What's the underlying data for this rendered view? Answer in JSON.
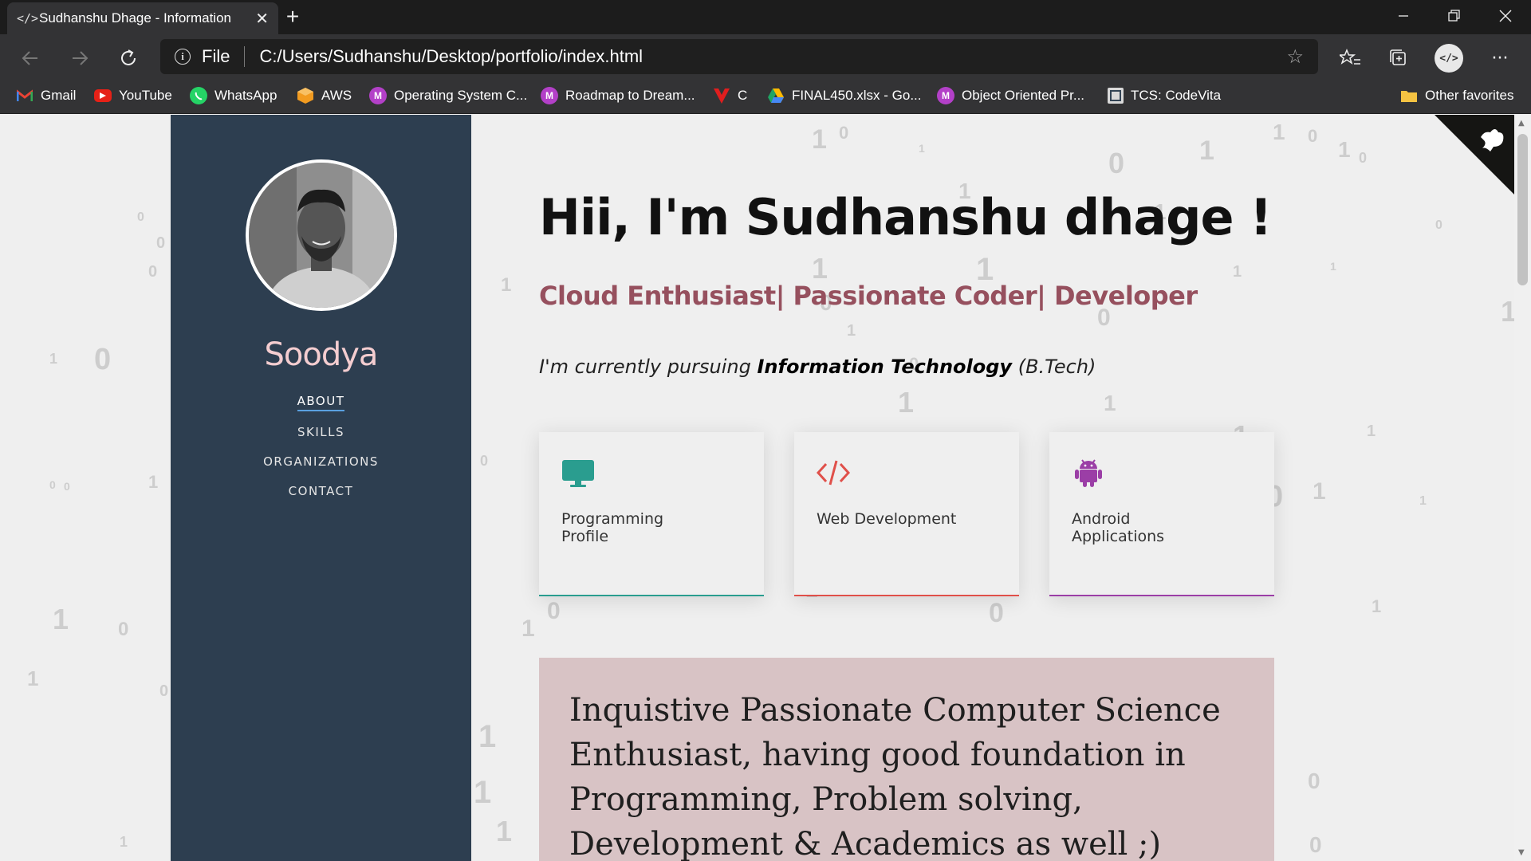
{
  "browser": {
    "tab_title": "Sudhanshu Dhage - Information",
    "tab_icon": "</>",
    "new_tab": "+",
    "scheme": "File",
    "url": "C:/Users/Sudhanshu/Desktop/portfolio/index.html",
    "profile_initials": "</>",
    "more": "···"
  },
  "bookmarks": [
    {
      "label": "Gmail",
      "icon": "gmail-icon"
    },
    {
      "label": "YouTube",
      "icon": "youtube-icon"
    },
    {
      "label": "WhatsApp",
      "icon": "whatsapp-icon"
    },
    {
      "label": "AWS",
      "icon": "aws-icon"
    },
    {
      "label": "Operating System C...",
      "icon": "m-icon"
    },
    {
      "label": "Roadmap to Dream...",
      "icon": "m-icon"
    },
    {
      "label": "C",
      "icon": "v-icon"
    },
    {
      "label": "FINAL450.xlsx - Go...",
      "icon": "drive-icon"
    },
    {
      "label": "Object Oriented Pr...",
      "icon": "m-icon"
    },
    {
      "label": "TCS: CodeVita",
      "icon": "codevita-icon"
    }
  ],
  "other_favorites": "Other favorites",
  "m_letter": "M",
  "sidebar": {
    "name": "Soodya",
    "nav": [
      "ABOUT",
      "SKILLS",
      "ORGANIZATIONS",
      "CONTACT"
    ]
  },
  "hero": {
    "title": "Hii, I'm Sudhanshu dhage !",
    "subtitle": "Cloud Enthusiast| Passionate Coder| Developer",
    "pursuit_prefix": "I'm currently pursuing ",
    "pursuit_field": "Information Technology",
    "pursuit_suffix": " (B.Tech)"
  },
  "cards": [
    {
      "label": "Programming Profile",
      "icon": "monitor-icon",
      "color": "#2a9d8f"
    },
    {
      "label": "Web Development",
      "icon": "code-icon",
      "color": "#e0504a"
    },
    {
      "label": "Android Applications",
      "icon": "android-icon",
      "color": "#9b3ea6"
    }
  ],
  "about": "Inquistive Passionate Computer Science Enthusiast, having good foundation in Programming, Problem solving, Development & Academics as well ;)",
  "colors": {
    "sidebar_bg": "#2d3e50",
    "name_color": "#f4cdd0",
    "subtitle_color": "#96505e",
    "about_bg": "#d8c3c5"
  }
}
